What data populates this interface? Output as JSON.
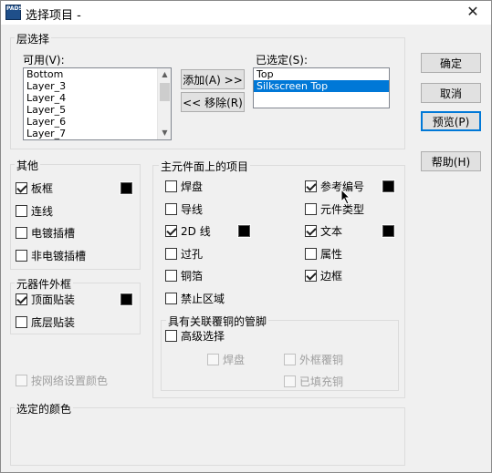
{
  "window": {
    "title": "选择项目 -",
    "app_icon_text": "PADS"
  },
  "layer_select": {
    "group_label": "层选择",
    "available_label": "可用(V):",
    "available_items": [
      "Bottom",
      "Layer_3",
      "Layer_4",
      "Layer_5",
      "Layer_6",
      "Layer_7"
    ],
    "selected_label": "已选定(S):",
    "selected_items": [
      "Top",
      "Silkscreen Top"
    ],
    "selected_highlight_index": 1,
    "add_button": "添加(A) >>",
    "remove_button": "<< 移除(R)"
  },
  "buttons": {
    "ok": "确定",
    "cancel": "取消",
    "preview": "预览(P)",
    "help": "帮助(H)"
  },
  "other": {
    "group_label": "其他",
    "items": [
      {
        "label": "板框",
        "checked": true,
        "swatch": "#000000"
      },
      {
        "label": "连线",
        "checked": false
      },
      {
        "label": "电镀插槽",
        "checked": false
      },
      {
        "label": "非电镀插槽",
        "checked": false
      }
    ]
  },
  "outline": {
    "group_label": "元器件外框",
    "items": [
      {
        "label": "顶面贴装",
        "checked": true,
        "swatch": "#000000"
      },
      {
        "label": "底层贴装",
        "checked": false
      }
    ]
  },
  "net_color": {
    "label": "按网络设置颜色",
    "checked": false,
    "disabled": true
  },
  "main_items": {
    "group_label": "主元件面上的项目",
    "left": [
      {
        "label": "焊盘",
        "checked": false
      },
      {
        "label": "导线",
        "checked": false
      },
      {
        "label": "2D 线",
        "checked": true,
        "swatch": "#000000"
      },
      {
        "label": "过孔",
        "checked": false
      },
      {
        "label": "铜箔",
        "checked": false
      },
      {
        "label": "禁止区域",
        "checked": false
      }
    ],
    "right": [
      {
        "label": "参考编号",
        "checked": true,
        "swatch": "#000000"
      },
      {
        "label": "元件类型",
        "checked": false
      },
      {
        "label": "文本",
        "checked": true,
        "swatch": "#000000"
      },
      {
        "label": "属性",
        "checked": false
      },
      {
        "label": "边框",
        "checked": true
      }
    ]
  },
  "copper_related": {
    "group_label": "具有关联覆铜的管脚",
    "advanced": {
      "label": "高级选择",
      "checked": false
    },
    "pad": {
      "label": "焊盘",
      "checked": false,
      "disabled": true
    },
    "outline_pour": {
      "label": "外框覆铜",
      "checked": false,
      "disabled": true
    },
    "filled_pour": {
      "label": "已填充铜",
      "checked": false,
      "disabled": true
    }
  },
  "selected_color": {
    "group_label": "选定的颜色"
  },
  "icons": {
    "close": "close-icon",
    "cursor": "mouse-pointer-icon",
    "app": "pads-app-icon"
  }
}
